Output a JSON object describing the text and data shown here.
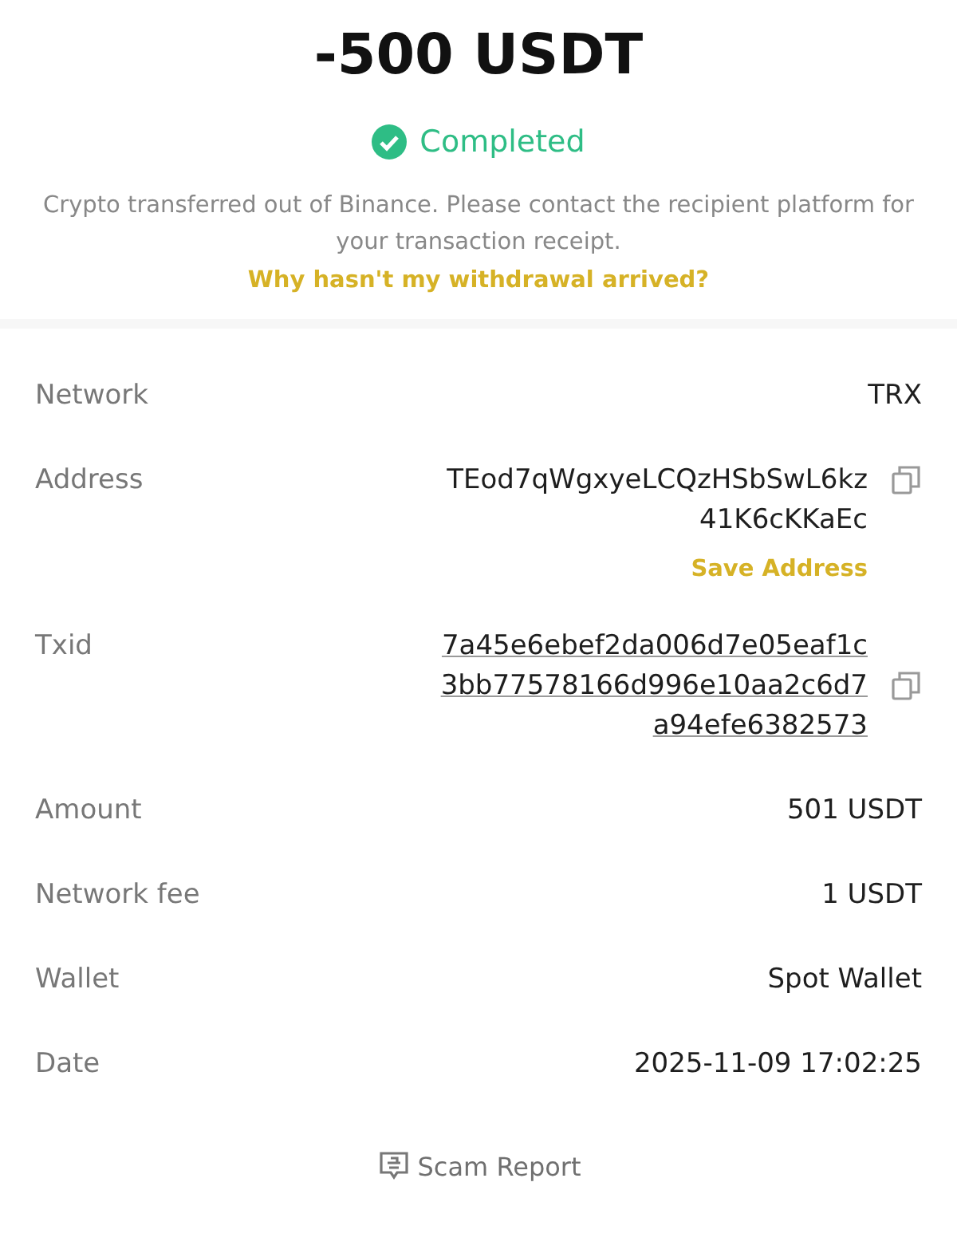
{
  "amount": "-500 USDT",
  "status": {
    "label": "Completed",
    "kind": "success"
  },
  "message": "Crypto transferred out of Binance. Please contact the recipient platform for your transaction receipt.",
  "help_link": "Why hasn't my withdrawal arrived?",
  "details": [
    {
      "kind": "plain",
      "label": "Network",
      "lines": [
        "TRX"
      ]
    },
    {
      "kind": "address",
      "label": "Address",
      "lines": [
        "TEod7qWgxyeLCQzHSbSwL6kz",
        "41K6cKKaEc"
      ],
      "action": "Save Address"
    },
    {
      "kind": "txid",
      "label": "Txid",
      "lines": [
        "7a45e6ebef2da006d7e05eaf1c",
        "3bb77578166d996e10aa2c6d7",
        "a94efe6382573"
      ]
    },
    {
      "kind": "plain",
      "label": "Amount",
      "lines": [
        "501 USDT"
      ]
    },
    {
      "kind": "plain",
      "label": "Network fee",
      "lines": [
        "1 USDT"
      ]
    },
    {
      "kind": "plain",
      "label": "Wallet",
      "lines": [
        "Spot Wallet"
      ]
    },
    {
      "kind": "plain",
      "label": "Date",
      "lines": [
        "2025-11-09 17:02:25"
      ]
    }
  ],
  "footer_link": "Scam Report"
}
